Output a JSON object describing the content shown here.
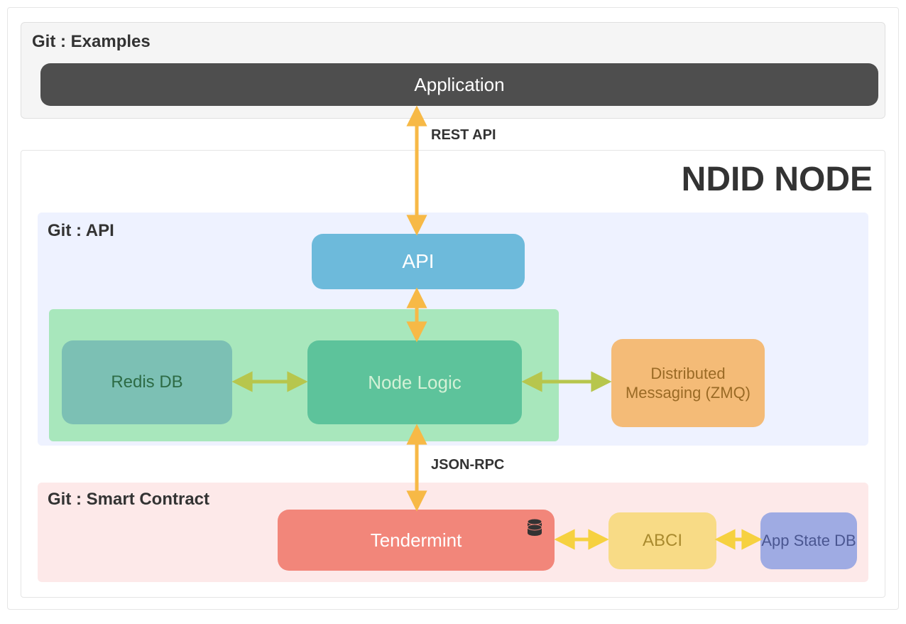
{
  "examples": {
    "label": "Git : Examples",
    "application_label": "Application"
  },
  "connections": {
    "rest_api": "REST API",
    "json_rpc": "JSON-RPC"
  },
  "ndid": {
    "title": "NDID NODE"
  },
  "api_panel": {
    "label": "Git : API",
    "api_box": "API",
    "redis": "Redis DB",
    "node_logic": "Node Logic",
    "zmq": "Distributed Messaging (ZMQ)"
  },
  "smart_contract": {
    "label": "Git : Smart Contract",
    "tendermint": "Tendermint",
    "abci": "ABCI",
    "app_state_db": "App State DB"
  }
}
